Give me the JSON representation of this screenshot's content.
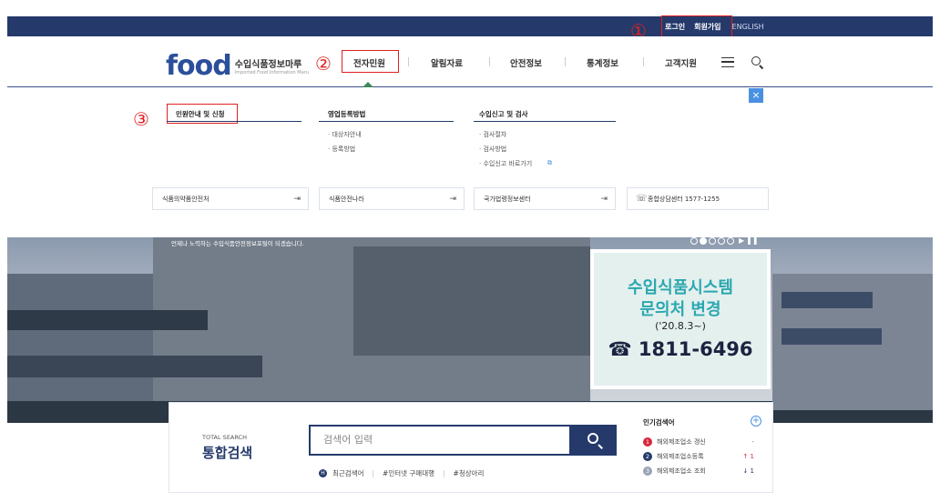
{
  "topbar": {
    "login": "로그인",
    "signup": "회원가입",
    "english": "ENGLISH"
  },
  "annotations": {
    "n1": "①",
    "n2": "②",
    "n3": "③"
  },
  "logo": {
    "word": "food",
    "title": "수입식품정보마루",
    "subtitle": "Imported Food Information Maru"
  },
  "nav": {
    "items": [
      "전자민원",
      "알림자료",
      "안전정보",
      "통계정보",
      "고객지원"
    ]
  },
  "dropdown": {
    "close": "×",
    "col1": {
      "title": "민원안내 및 신청",
      "items": []
    },
    "col2": {
      "title": "영업등록방법",
      "items": [
        "· 대상자안내",
        "· 등록방법"
      ]
    },
    "col3": {
      "title": "수입신고 및 검사",
      "items": [
        "· 검사절차",
        "· 검사방법",
        "· 수입신고 바로가기"
      ]
    },
    "quick": [
      "식품의약품안전처",
      "식품안전나라",
      "국가법령정보센터",
      "종합상담센터 1577-1255"
    ]
  },
  "hero": {
    "caption": "언제나 노력하는 수입식품안전정보포털이 되겠습니다.",
    "slide_current": 2,
    "slide_total": 5,
    "banner_line1": "수입식품시스템",
    "banner_line2": "문의처 변경",
    "banner_line3": "('20.8.3~)",
    "banner_line4": "☎ 1811-6496"
  },
  "search": {
    "label_en": "TOTAL SEARCH",
    "label_ko": "통합검색",
    "placeholder": "검색어 입력",
    "recent_label": "최근검색어",
    "tags": [
      "#인터넷 구매대행",
      "#청상아리"
    ],
    "popular_title": "인기검색어",
    "popular": [
      {
        "rank": "1",
        "term": "해외제조업소 갱신",
        "change": "-",
        "color": "#d7263d",
        "change_color": "#777"
      },
      {
        "rank": "2",
        "term": "해외제조업소등록",
        "change": "↑ 1",
        "color": "#253a6b",
        "change_color": "#d7263d"
      },
      {
        "rank": "3",
        "term": "해외제조업소 조회",
        "change": "↓ 1",
        "color": "#9aa3b5",
        "change_color": "#253a6b"
      }
    ]
  }
}
